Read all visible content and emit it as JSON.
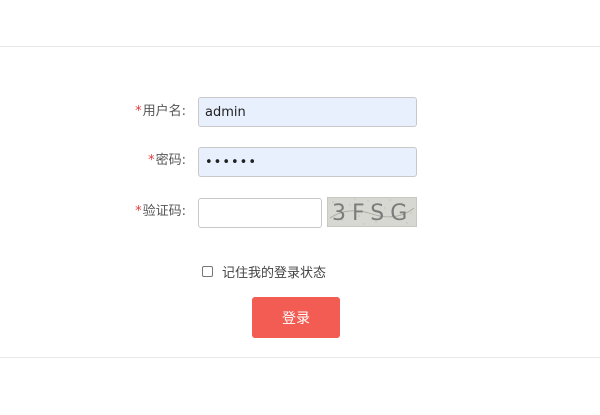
{
  "form": {
    "username": {
      "required_mark": "*",
      "label": "用户名:",
      "value": "admin"
    },
    "password": {
      "required_mark": "*",
      "label": "密码:",
      "value": "••••••"
    },
    "captcha": {
      "required_mark": "*",
      "label": "验证码:",
      "value": "",
      "image_text": "3FSG"
    },
    "remember_label": "记住我的登录状态",
    "remember_checked": false,
    "submit_label": "登录"
  },
  "colors": {
    "required": "#e4393c",
    "button": "#f25c52",
    "autofill_bg": "#e8f0fe"
  }
}
